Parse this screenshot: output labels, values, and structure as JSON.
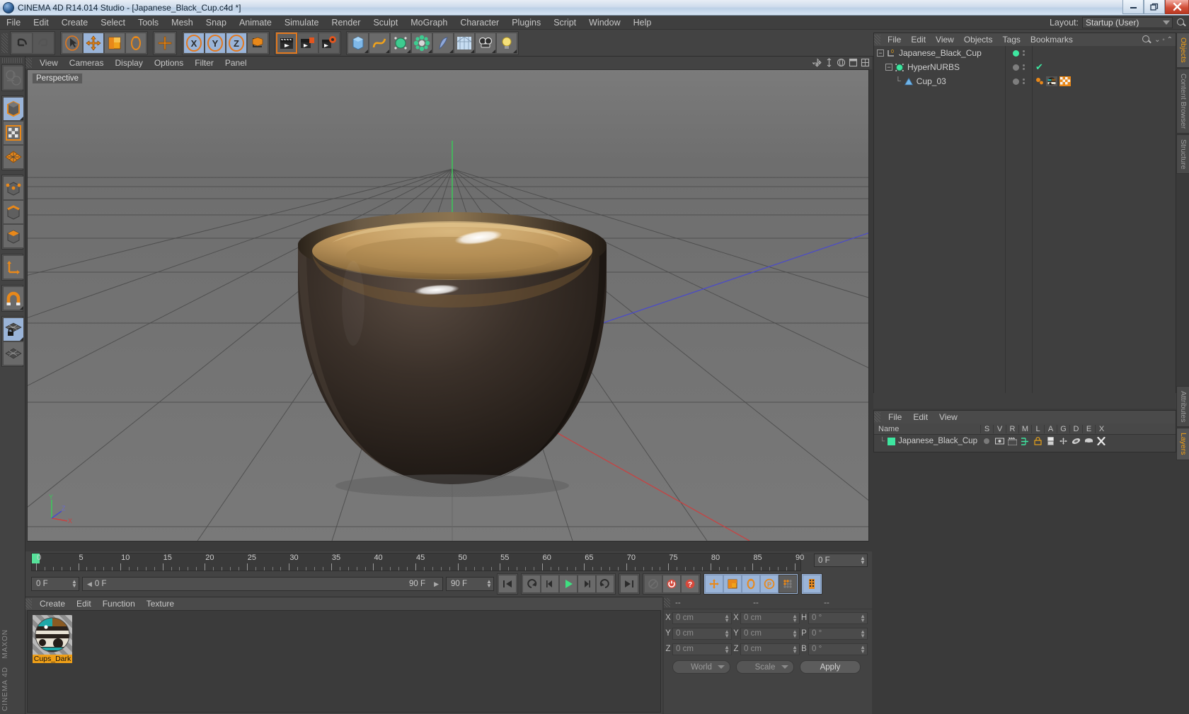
{
  "window": {
    "title": "CINEMA 4D R14.014 Studio - [Japanese_Black_Cup.c4d *]",
    "minimize": "—",
    "maximize": "❐",
    "close": "✕"
  },
  "menu": {
    "items": [
      "File",
      "Edit",
      "Create",
      "Select",
      "Tools",
      "Mesh",
      "Snap",
      "Animate",
      "Simulate",
      "Render",
      "Sculpt",
      "MoGraph",
      "Character",
      "Plugins",
      "Script",
      "Window",
      "Help"
    ],
    "layout_label": "Layout:",
    "layout_value": "Startup (User)"
  },
  "toolbar": {
    "groups": [
      {
        "name": "history",
        "buttons": [
          {
            "name": "undo-button",
            "icon": "undo",
            "state": "normal"
          },
          {
            "name": "redo-button",
            "icon": "redo",
            "state": "disabled"
          }
        ]
      },
      {
        "name": "transform",
        "buttons": [
          {
            "name": "select-tool",
            "icon": "cursor",
            "state": "normal"
          },
          {
            "name": "move-tool",
            "icon": "move",
            "state": "active"
          },
          {
            "name": "scale-tool",
            "icon": "scale",
            "state": "normal"
          },
          {
            "name": "rotate-tool",
            "icon": "rotate",
            "state": "normal"
          }
        ]
      },
      {
        "name": "placeholder",
        "buttons": [
          {
            "name": "cursor-cross-tool",
            "icon": "cross",
            "state": "normal"
          }
        ]
      },
      {
        "name": "axis-locks",
        "buttons": [
          {
            "name": "lock-x-axis",
            "icon": "X",
            "state": "active"
          },
          {
            "name": "lock-y-axis",
            "icon": "Y",
            "state": "active"
          },
          {
            "name": "lock-z-axis",
            "icon": "Z",
            "state": "active"
          },
          {
            "name": "world-object-axis",
            "icon": "axis-cube",
            "state": "normal"
          }
        ]
      },
      {
        "name": "render",
        "buttons": [
          {
            "name": "render-view-button",
            "icon": "clapper",
            "state": "normal"
          },
          {
            "name": "render-region-button",
            "icon": "clapper-region",
            "state": "normal"
          },
          {
            "name": "render-settings-button",
            "icon": "clapper-gear",
            "state": "normal"
          }
        ]
      },
      {
        "name": "create",
        "buttons": [
          {
            "name": "add-cube-button",
            "icon": "cube",
            "state": "normal"
          },
          {
            "name": "add-spline-button",
            "icon": "spline",
            "state": "normal"
          },
          {
            "name": "nurbs-button",
            "icon": "hypernurbs",
            "state": "normal"
          },
          {
            "name": "array-button",
            "icon": "modeling-object",
            "state": "normal"
          },
          {
            "name": "deformer-button",
            "icon": "bend",
            "state": "normal"
          },
          {
            "name": "environment-button",
            "icon": "floor",
            "state": "normal"
          },
          {
            "name": "camera-button",
            "icon": "camera",
            "state": "normal"
          },
          {
            "name": "light-button",
            "icon": "light",
            "state": "normal"
          }
        ]
      }
    ]
  },
  "left_toolbar": {
    "buttons": [
      {
        "name": "viewport-navigation-tool",
        "icon": "globe-arrows",
        "state": "disabled"
      },
      {
        "name": "model-mode-button",
        "icon": "cube-solid",
        "state": "active"
      },
      {
        "name": "texture-mode-button",
        "icon": "checker",
        "state": "normal"
      },
      {
        "name": "polygon-mesh-button",
        "icon": "mesh-grid",
        "state": "normal"
      },
      {
        "name": "point-mode-button",
        "icon": "cube-points",
        "state": "normal"
      },
      {
        "name": "edge-mode-button",
        "icon": "cube-edges",
        "state": "normal"
      },
      {
        "name": "polygon-mode-button",
        "icon": "cube-polygons",
        "state": "normal"
      },
      {
        "name": "axis-mode-button",
        "icon": "axis-arrows",
        "state": "normal"
      },
      {
        "name": "snap-button",
        "icon": "magnet",
        "state": "normal"
      },
      {
        "name": "lock-workplane-button",
        "icon": "grid-lock",
        "state": "active"
      },
      {
        "name": "workplane-button",
        "icon": "grid-plane",
        "state": "normal"
      }
    ],
    "branding_top": "MAXON",
    "branding_bottom": "CINEMA 4D"
  },
  "viewport": {
    "menu": [
      "View",
      "Cameras",
      "Display",
      "Options",
      "Filter",
      "Panel"
    ],
    "label": "Perspective",
    "axis_labels": {
      "x": "X",
      "y": "Y",
      "z": "Z"
    },
    "corner_icons": [
      "pan-icon",
      "dolly-icon",
      "orbit-icon",
      "maximize-icon",
      "layout-icon"
    ]
  },
  "timeline": {
    "ticks": [
      0,
      5,
      10,
      15,
      20,
      25,
      30,
      35,
      40,
      45,
      50,
      55,
      60,
      65,
      70,
      75,
      80,
      85,
      90
    ],
    "current_frame_field": "0 F",
    "start_frame": "0 F",
    "preview_end": "90 F",
    "end_frame": "90 F",
    "frame_field_right": "0 F",
    "transport": [
      {
        "name": "go-to-start-button",
        "icon": "skip-back"
      },
      {
        "name": "previous-key-button",
        "icon": "prev-key"
      },
      {
        "name": "step-back-button",
        "icon": "step-back"
      },
      {
        "name": "play-button",
        "icon": "play"
      },
      {
        "name": "step-forward-button",
        "icon": "step-forward"
      },
      {
        "name": "next-key-button",
        "icon": "next-key"
      },
      {
        "name": "go-to-end-button",
        "icon": "skip-forward"
      }
    ],
    "record_group": [
      {
        "name": "record-active-objects-button",
        "icon": "key-disabled"
      },
      {
        "name": "autokeying-button",
        "icon": "power-red"
      },
      {
        "name": "keyframe-selection-button",
        "icon": "question-red"
      }
    ],
    "key_toggles": [
      {
        "name": "position-key-button",
        "icon": "move-key"
      },
      {
        "name": "scale-key-button",
        "icon": "scale-key"
      },
      {
        "name": "rotation-key-button",
        "icon": "rotate-key"
      },
      {
        "name": "parameter-key-button",
        "icon": "param-key"
      },
      {
        "name": "point-level-animation-button",
        "icon": "pla-key"
      }
    ],
    "filmstrip_button": {
      "name": "timeline-button",
      "icon": "filmstrip"
    }
  },
  "material_manager": {
    "menu": [
      "Create",
      "Edit",
      "Function",
      "Texture"
    ],
    "materials": [
      {
        "name": "Cups_Dark",
        "selected": true
      }
    ]
  },
  "coordinates": {
    "headers": [
      "--",
      "--",
      "--"
    ],
    "rows": [
      {
        "l1": "X",
        "v1": "0 cm",
        "l2": "X",
        "v2": "0 cm",
        "l3": "H",
        "v3": "0 °"
      },
      {
        "l1": "Y",
        "v1": "0 cm",
        "l2": "Y",
        "v2": "0 cm",
        "l3": "P",
        "v3": "0 °"
      },
      {
        "l1": "Z",
        "v1": "0 cm",
        "l2": "Z",
        "v2": "0 cm",
        "l3": "B",
        "v3": "0 °"
      }
    ],
    "space_select": "World",
    "mode_select": "Scale",
    "apply_label": "Apply"
  },
  "object_manager": {
    "menu": [
      "File",
      "Edit",
      "View",
      "Objects",
      "Tags",
      "Bookmarks"
    ],
    "objects": [
      {
        "name": "Japanese_Black_Cup",
        "depth": 0,
        "icon": "null-object-icon",
        "dot": "green",
        "expanded": true,
        "layer_color": "#3ee6a0"
      },
      {
        "name": "HyperNURBS",
        "depth": 1,
        "icon": "hypernurbs-icon",
        "dot": "gray",
        "expanded": true,
        "check": true
      },
      {
        "name": "Cup_03",
        "depth": 2,
        "icon": "polygon-object-icon",
        "dot": "gray",
        "expanded": false,
        "tags": [
          "material-tag",
          "texture-tag"
        ]
      }
    ]
  },
  "layer_manager": {
    "menu": [
      "File",
      "Edit",
      "View"
    ],
    "columns": [
      "Name",
      "S",
      "V",
      "R",
      "M",
      "L",
      "A",
      "G",
      "D",
      "E",
      "X"
    ],
    "rows": [
      {
        "name": "Japanese_Black_Cup",
        "color": "#3ee6a0"
      }
    ]
  },
  "right_tabs": {
    "top": [
      {
        "label": "Objects",
        "selected": true
      },
      {
        "label": "Content Browser",
        "selected": false
      },
      {
        "label": "Structure",
        "selected": false
      }
    ],
    "bottom": [
      {
        "label": "Attributes",
        "selected": false
      },
      {
        "label": "Layers",
        "selected": true
      }
    ]
  },
  "colors": {
    "accent_orange": "#f0a018",
    "green": "#3ee6a0",
    "panel": "#434343",
    "viewport_bg": "#6e6e6e",
    "cup_body": "#2e2722",
    "cup_interior": "#c8a268"
  }
}
